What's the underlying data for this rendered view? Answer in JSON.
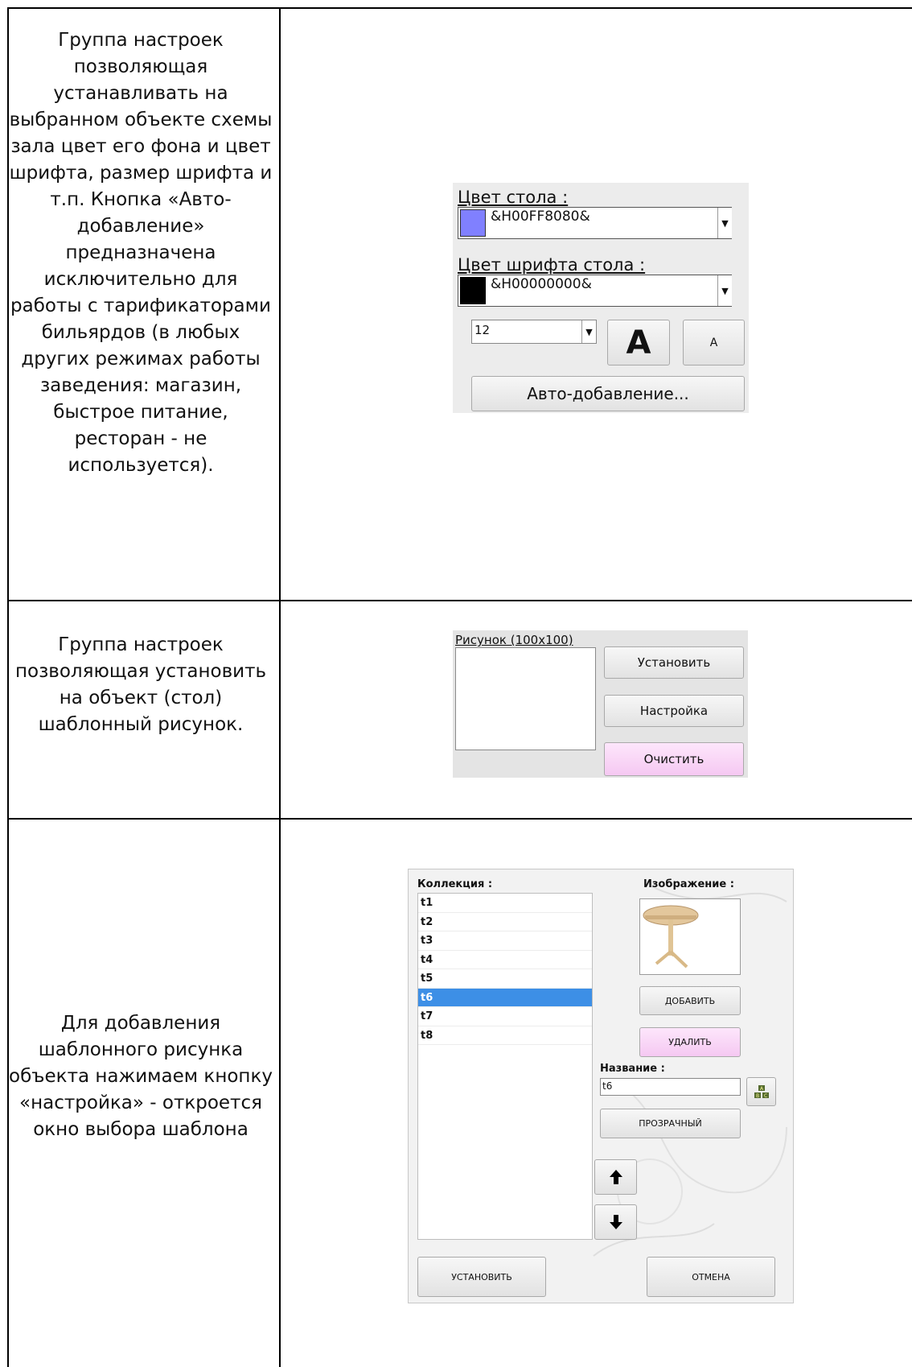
{
  "rows": [
    {
      "description": "Группа настроек позволяющая устанавливать на выбранном объекте схемы зала цвет его фона и цвет шрифта, размер шрифта и т.п. Кнопка «Авто-добавление» предназначена исключительно для работы с тарификаторами бильярдов (в любых других режимах работы заведения: магазин, быстрое питание, ресторан - не используется).",
      "panel": {
        "table_color_label": "Цвет стола :",
        "table_color_value": "&H00FF8080&",
        "table_color_swatch": "#8080ff",
        "font_color_label": "Цвет шрифта стола :",
        "font_color_value": "&H00000000&",
        "font_color_swatch": "#000000",
        "font_size": "12",
        "bigger_font_label": "A",
        "smaller_font_label": "A",
        "auto_add_label": "Авто-добавление..."
      }
    },
    {
      "description": "Группа настроек позволяющая установить на объект (стол) шаблонный рисунок.",
      "panel": {
        "picture_label": "Рисунок (100x100)",
        "set_label": "Установить",
        "settings_label": "Настройка",
        "clear_label": "Очистить"
      }
    },
    {
      "description": "Для добавления шаблонного рисунка объекта нажимаем кнопку «настройка» - откроется окно выбора шаблона",
      "panel": {
        "collection_label": "Коллекция :",
        "collection_items": [
          "t1",
          "t2",
          "t3",
          "t4",
          "t5",
          "t6",
          "t7",
          "t8"
        ],
        "selected_item": "t6",
        "image_label": "Изображение :",
        "add_label": "ДОБАВИТЬ",
        "delete_label": "УДАЛИТЬ",
        "name_label": "Название :",
        "name_value": "t6",
        "transparent_label": "ПРОЗРАЧНЫЙ",
        "set_label": "УСТАНОВИТЬ",
        "cancel_label": "ОТМЕНА",
        "keyboard_icon": "abc-keyboard-icon",
        "up_icon": "arrow-up-icon",
        "down_icon": "arrow-down-icon"
      }
    }
  ]
}
